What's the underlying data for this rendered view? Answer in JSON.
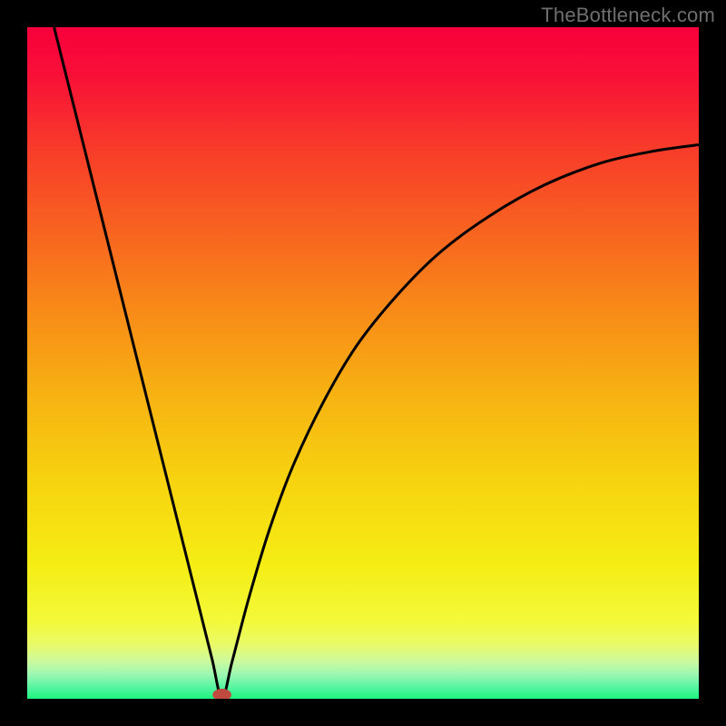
{
  "watermark": "TheBottleneck.com",
  "colors": {
    "frame": "#000000",
    "curve": "#000000",
    "marker_fill": "#bf4a3f",
    "gradient_stops": [
      {
        "offset": 0.0,
        "color": "#f7003c"
      },
      {
        "offset": 0.07,
        "color": "#f80f37"
      },
      {
        "offset": 0.18,
        "color": "#f83b2a"
      },
      {
        "offset": 0.3,
        "color": "#f86220"
      },
      {
        "offset": 0.42,
        "color": "#f88a18"
      },
      {
        "offset": 0.55,
        "color": "#f7b312"
      },
      {
        "offset": 0.68,
        "color": "#f7d410"
      },
      {
        "offset": 0.8,
        "color": "#f5ed14"
      },
      {
        "offset": 0.885,
        "color": "#f3f93a"
      },
      {
        "offset": 0.92,
        "color": "#e8fa69"
      },
      {
        "offset": 0.945,
        "color": "#cbf9a0"
      },
      {
        "offset": 0.965,
        "color": "#98f7b2"
      },
      {
        "offset": 0.985,
        "color": "#4ef59d"
      },
      {
        "offset": 1.0,
        "color": "#1df37f"
      }
    ]
  },
  "chart_data": {
    "type": "line",
    "title": "",
    "xlabel": "",
    "ylabel": "",
    "xlim": [
      0,
      1
    ],
    "ylim": [
      0,
      1
    ],
    "minimum": {
      "x": 0.29,
      "y": 0.0
    },
    "left_start": {
      "x": 0.04,
      "y": 1.0
    },
    "right_end": {
      "x": 1.0,
      "y": 0.825
    },
    "series": [
      {
        "name": "curve",
        "points": [
          {
            "x": 0.04,
            "y": 1.0
          },
          {
            "x": 0.07,
            "y": 0.88
          },
          {
            "x": 0.1,
            "y": 0.76
          },
          {
            "x": 0.13,
            "y": 0.64
          },
          {
            "x": 0.16,
            "y": 0.52
          },
          {
            "x": 0.19,
            "y": 0.4
          },
          {
            "x": 0.22,
            "y": 0.28
          },
          {
            "x": 0.25,
            "y": 0.16
          },
          {
            "x": 0.275,
            "y": 0.06
          },
          {
            "x": 0.29,
            "y": 0.0
          },
          {
            "x": 0.305,
            "y": 0.055
          },
          {
            "x": 0.33,
            "y": 0.15
          },
          {
            "x": 0.36,
            "y": 0.25
          },
          {
            "x": 0.395,
            "y": 0.345
          },
          {
            "x": 0.44,
            "y": 0.44
          },
          {
            "x": 0.49,
            "y": 0.525
          },
          {
            "x": 0.55,
            "y": 0.6
          },
          {
            "x": 0.615,
            "y": 0.665
          },
          {
            "x": 0.69,
            "y": 0.72
          },
          {
            "x": 0.77,
            "y": 0.765
          },
          {
            "x": 0.855,
            "y": 0.798
          },
          {
            "x": 0.93,
            "y": 0.815
          },
          {
            "x": 1.0,
            "y": 0.825
          }
        ]
      }
    ],
    "marker": {
      "x": 0.29,
      "y": 0.006,
      "rx": 0.014,
      "ry": 0.009
    }
  }
}
